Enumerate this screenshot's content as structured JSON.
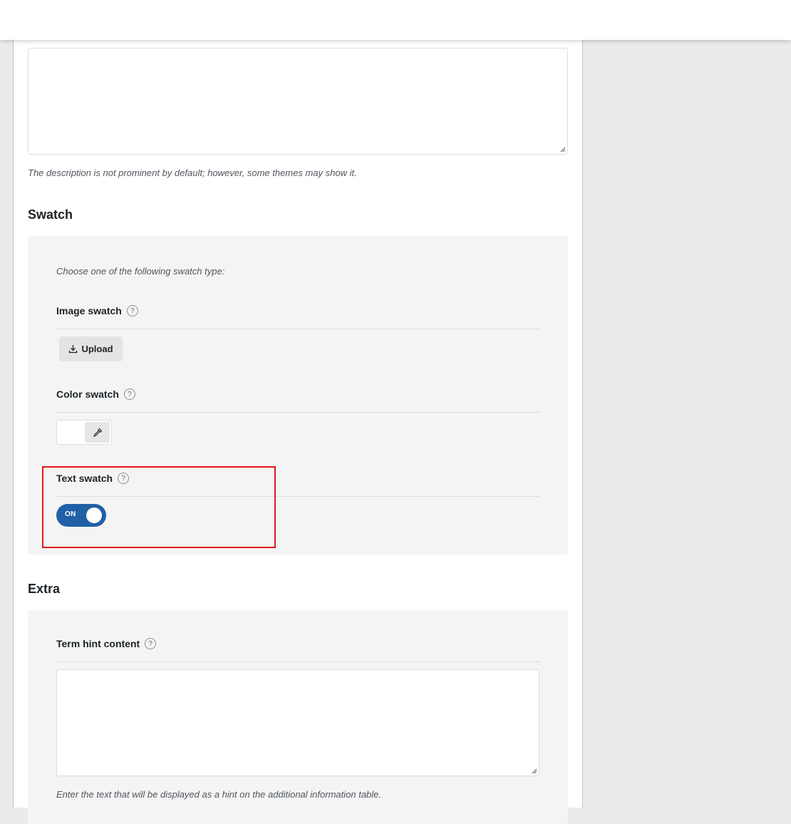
{
  "description": {
    "help_text": "The description is not prominent by default; however, some themes may show it."
  },
  "swatch": {
    "title": "Swatch",
    "intro": "Choose one of the following swatch type:",
    "image_swatch": {
      "label": "Image swatch",
      "upload_label": "Upload"
    },
    "color_swatch": {
      "label": "Color swatch"
    },
    "text_swatch": {
      "label": "Text swatch",
      "toggle_label": "ON",
      "enabled": true
    }
  },
  "extra": {
    "title": "Extra",
    "term_hint": {
      "label": "Term hint content",
      "help_text": "Enter the text that will be displayed as a hint on the additional information table."
    }
  },
  "help_icon_glyph": "?",
  "colors": {
    "toggle_on": "#2160a6",
    "highlight": "#e5141b"
  },
  "icons": [
    "question-icon",
    "download-icon",
    "eyedropper-icon"
  ]
}
